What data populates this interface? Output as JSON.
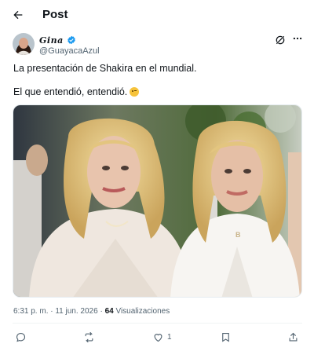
{
  "header": {
    "title": "Post"
  },
  "author": {
    "display_name": "Gina",
    "handle": "@GuayacaAzul",
    "verified": true
  },
  "tweet": {
    "line1": "La presentación de Shakira en el mundial.",
    "line2": "El que entendió, entendió.",
    "emoji": "winking-face"
  },
  "meta": {
    "time": "6:31 p. m.",
    "separator": " · ",
    "date": "11 jun. 2026",
    "views_count": "64",
    "views_label": " Visualizaciones"
  },
  "actions": {
    "likes": "1"
  },
  "colors": {
    "text": "#0f1419",
    "secondary": "#536471",
    "verified": "#1d9bf0",
    "divider": "#eff3f4"
  }
}
